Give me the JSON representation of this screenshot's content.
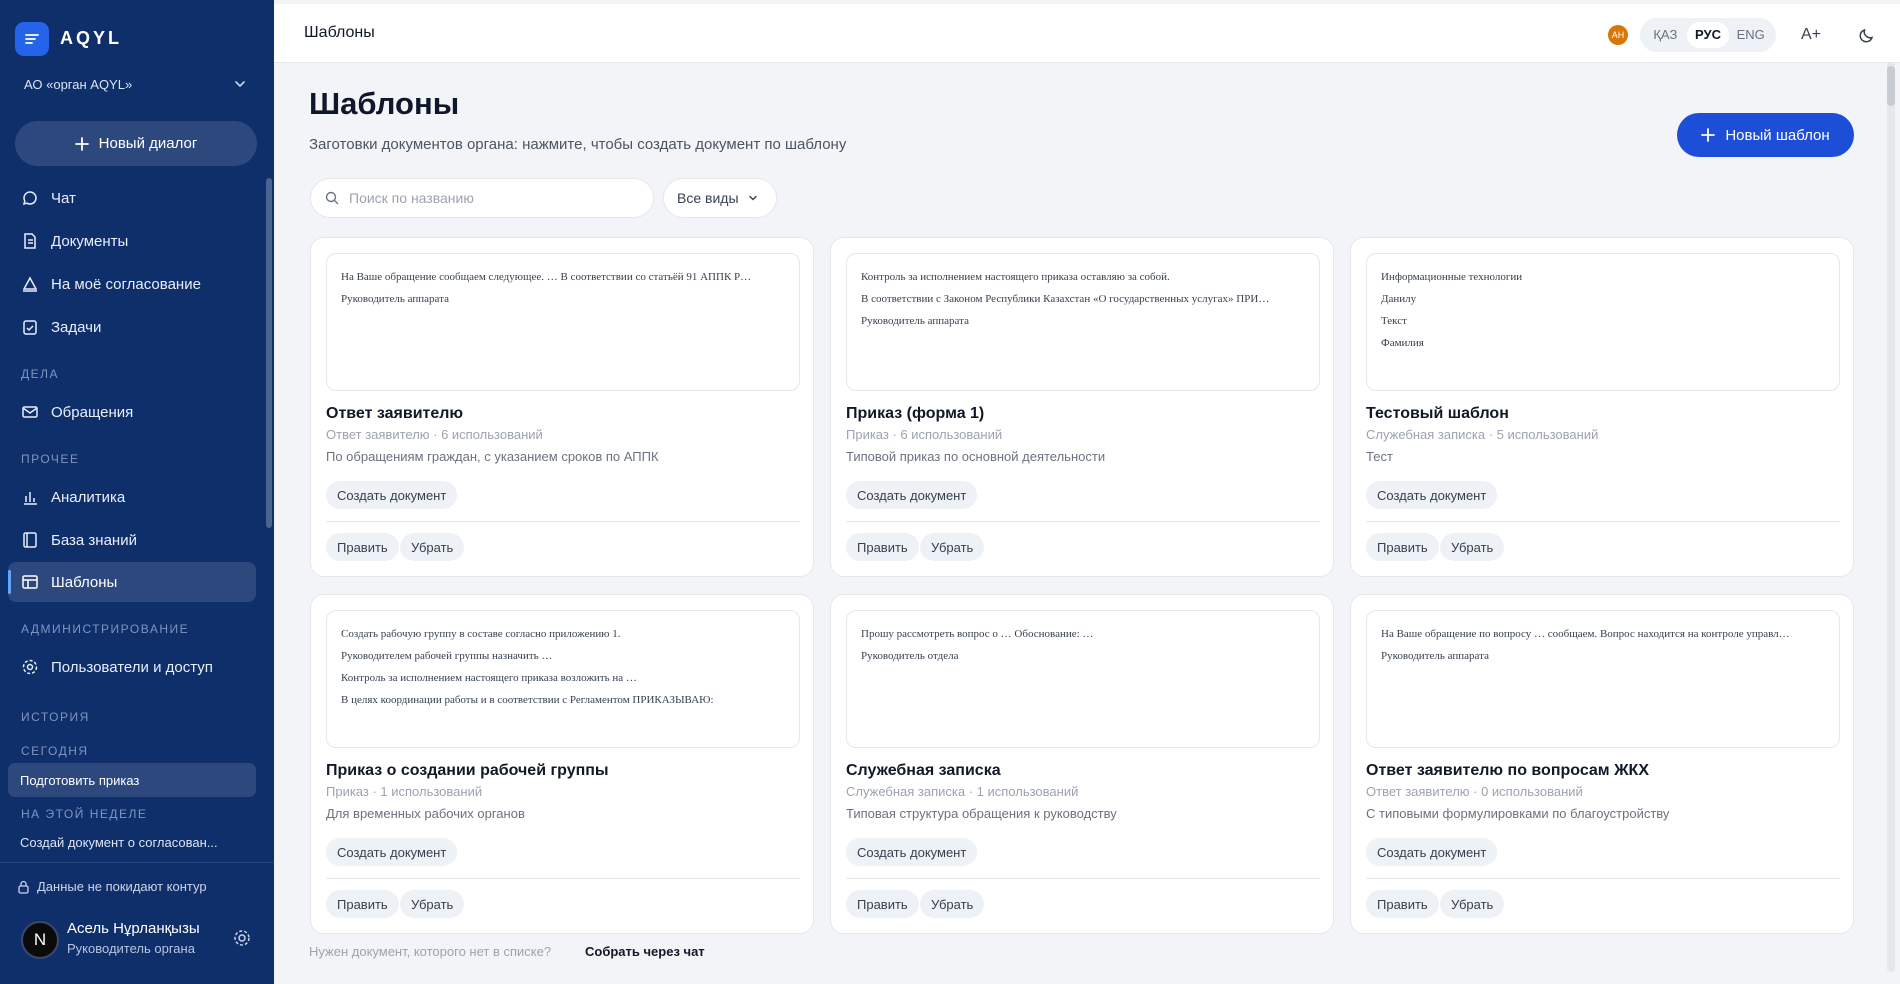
{
  "app": {
    "name": "AQYL",
    "org": "АО «орган AQYL»",
    "new_dialog": "Новый диалог"
  },
  "nav": {
    "chat": "Чат",
    "documents": "Документы",
    "approval": "На моё согласование",
    "tasks": "Задачи",
    "sec_cases": "ДЕЛА",
    "appeals": "Обращения",
    "sec_other": "ПРОЧЕЕ",
    "analytics": "Аналитика",
    "knowledge": "База знаний",
    "templates": "Шаблоны",
    "sec_admin": "АДМИНИСТРИРОВАНИЕ",
    "users": "Пользователи и доступ"
  },
  "history": {
    "title": "ИСТОРИЯ",
    "today": "СЕГОДНЯ",
    "item1": "Подготовить приказ",
    "week": "НА ЭТОЙ НЕДЕЛЕ",
    "item2": "Создай документ о согласован..."
  },
  "security_note": "Данные не покидают контур",
  "user": {
    "initial": "N",
    "name": "Асель Нұрланқызы",
    "role": "Руководитель органа"
  },
  "topbar": {
    "title": "Шаблоны",
    "avatar": "AH",
    "lang_kz": "ҚАЗ",
    "lang_ru": "РУС",
    "lang_en": "ENG",
    "font_size": "A+"
  },
  "page": {
    "title": "Шаблоны",
    "subtitle": "Заготовки документов органа: нажмите, чтобы создать документ по шаблону",
    "new_template": "Новый шаблон",
    "search_placeholder": "Поиск по названию",
    "filter": "Все виды"
  },
  "actions": {
    "create": "Создать документ",
    "edit": "Править",
    "remove": "Убрать"
  },
  "cards": [
    {
      "title": "Ответ заявителю",
      "meta": "Ответ заявителю · 6 использований",
      "desc": "По обращениям граждан, с указанием сроков по АППК",
      "preview": [
        "На Ваше обращение сообщаем следующее. … В соответствии со статьёй 91 АППК Р…",
        "Руководитель аппарата"
      ]
    },
    {
      "title": "Приказ (форма 1)",
      "meta": "Приказ · 6 использований",
      "desc": "Типовой приказ по основной деятельности",
      "preview": [
        "Контроль за исполнением настоящего приказа оставляю за собой.",
        "В соответствии с Законом Республики Казахстан «О государственных услугах» ПРИ…",
        "Руководитель аппарата"
      ]
    },
    {
      "title": "Тестовый шаблон",
      "meta": "Служебная записка · 5 использований",
      "desc": "Тест",
      "preview": [
        "Информационные технологии",
        "Данилу",
        "Текст",
        "Фамилия"
      ]
    },
    {
      "title": "Приказ о создании рабочей группы",
      "meta": "Приказ · 1 использований",
      "desc": "Для временных рабочих органов",
      "preview": [
        "Создать рабочую группу в составе согласно приложению 1.",
        "Руководителем рабочей группы назначить …",
        "Контроль за исполнением настоящего приказа возложить на …",
        "В целях координации работы и в соответствии с Регламентом ПРИКАЗЫВАЮ:"
      ]
    },
    {
      "title": "Служебная записка",
      "meta": "Служебная записка · 1 использований",
      "desc": "Типовая структура обращения к руководству",
      "preview": [
        "Прошу рассмотреть вопрос о … Обоснование: …",
        "Руководитель отдела"
      ]
    },
    {
      "title": "Ответ заявителю по вопросам ЖКХ",
      "meta": "Ответ заявителю · 0 использований",
      "desc": "С типовыми формулировками по благоустройству",
      "preview": [
        "На Ваше обращение по вопросу … сообщаем. Вопрос находится на контроле управл…",
        "Руководитель аппарата"
      ]
    }
  ],
  "footer": {
    "question": "Нужен документ, которого нет в списке?",
    "link": "Собрать через чат"
  },
  "colors": {
    "sidebar": "#0f2f6b",
    "accent": "#1d4ed8",
    "avatar_small": "#d97706"
  }
}
